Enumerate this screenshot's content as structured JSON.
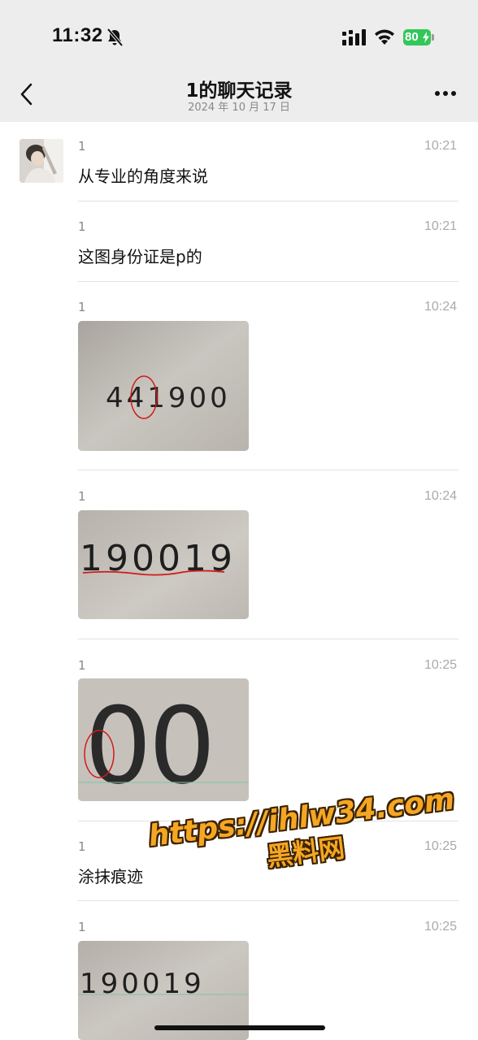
{
  "status_bar": {
    "time": "11:32",
    "battery_level": "80",
    "colors": {
      "battery": "#33c759",
      "background": "#ededed"
    }
  },
  "header": {
    "title": "1的聊天记录",
    "date": "2024 年 10 月 17 日",
    "icons": {
      "back": "chevron-left-icon",
      "more": "more-dots-icon"
    }
  },
  "messages": [
    {
      "sender": "1",
      "time": "10:21",
      "type": "text",
      "text": "从专业的角度来说"
    },
    {
      "sender": "1",
      "time": "10:21",
      "type": "text",
      "text": "这图身份证是p的"
    },
    {
      "sender": "1",
      "time": "10:24",
      "type": "image",
      "image_text": "441900"
    },
    {
      "sender": "1",
      "time": "10:24",
      "type": "image",
      "image_text": "190019"
    },
    {
      "sender": "1",
      "time": "10:25",
      "type": "image",
      "image_text": "00"
    },
    {
      "sender": "1",
      "time": "10:25",
      "type": "text",
      "text": "涂抹痕迹"
    },
    {
      "sender": "1",
      "time": "10:25",
      "type": "image",
      "image_text": "190019"
    }
  ],
  "watermark": {
    "line1": "https://ihlw34.com",
    "line2": "黑料网",
    "color": "#f5a623"
  }
}
